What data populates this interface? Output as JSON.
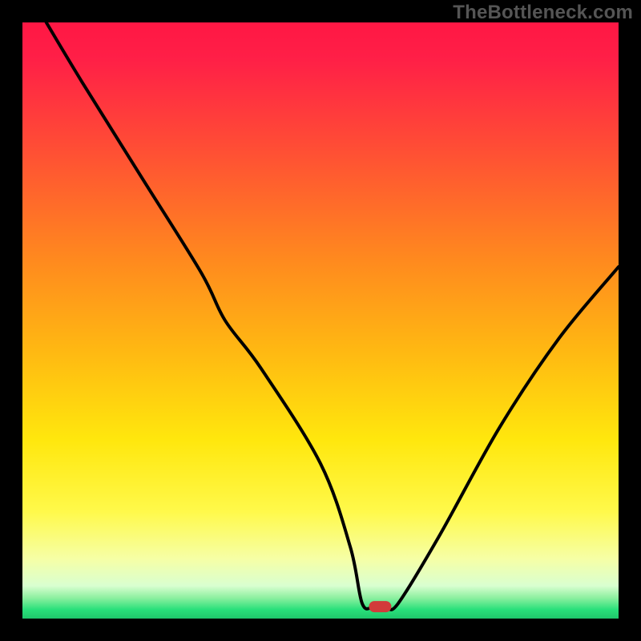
{
  "watermark": "TheBottleneck.com",
  "chart_data": {
    "type": "line",
    "title": "",
    "xlabel": "",
    "ylabel": "",
    "xlim": [
      0,
      100
    ],
    "ylim": [
      0,
      100
    ],
    "grid": false,
    "legend": false,
    "series": [
      {
        "name": "bottleneck-curve",
        "x": [
          4,
          10,
          20,
          30,
          34,
          40,
          50,
          55,
          57,
          59,
          61,
          63,
          70,
          80,
          90,
          100
        ],
        "y": [
          100,
          90,
          74,
          58,
          50,
          42,
          26,
          12,
          2.5,
          2,
          2,
          2.5,
          14,
          32,
          47,
          59
        ]
      }
    ],
    "markers": [
      {
        "name": "optimal-point",
        "x": 60,
        "y": 2,
        "color": "#d23a3a"
      }
    ],
    "gradient_stops": [
      {
        "offset": 0.0,
        "color": "#ff1744"
      },
      {
        "offset": 0.06,
        "color": "#ff1f47"
      },
      {
        "offset": 0.2,
        "color": "#ff4a36"
      },
      {
        "offset": 0.4,
        "color": "#ff8a1e"
      },
      {
        "offset": 0.55,
        "color": "#ffb812"
      },
      {
        "offset": 0.7,
        "color": "#ffe70d"
      },
      {
        "offset": 0.82,
        "color": "#fff94a"
      },
      {
        "offset": 0.9,
        "color": "#f6ffa6"
      },
      {
        "offset": 0.945,
        "color": "#d9ffd0"
      },
      {
        "offset": 0.965,
        "color": "#8ef0a0"
      },
      {
        "offset": 0.985,
        "color": "#29e07a"
      },
      {
        "offset": 1.0,
        "color": "#1fc76b"
      }
    ]
  }
}
